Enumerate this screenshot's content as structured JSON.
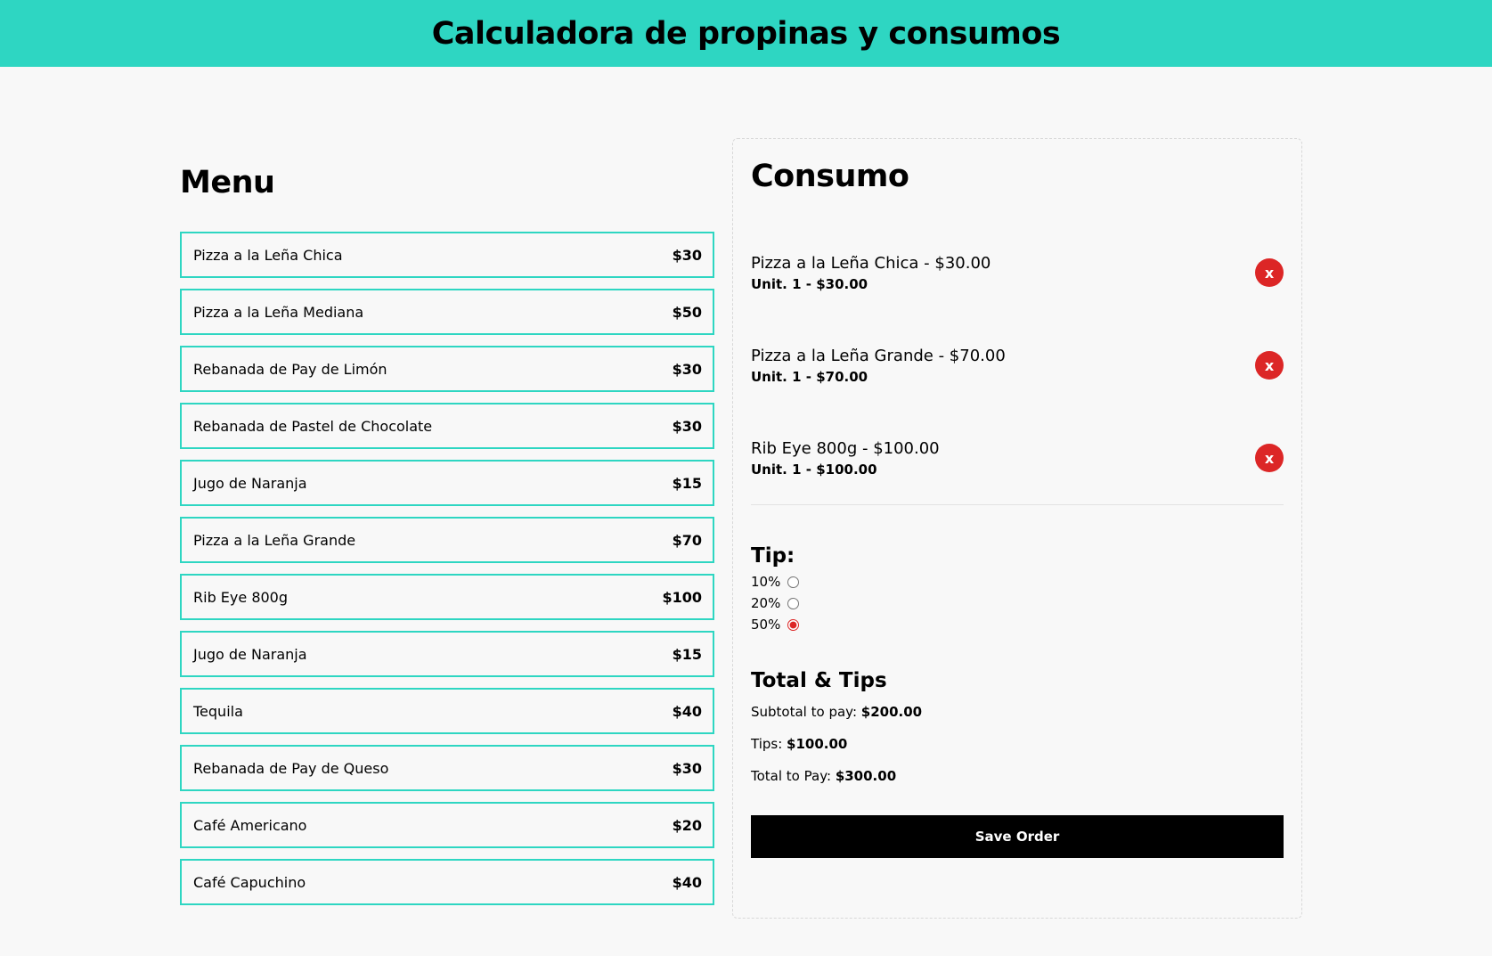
{
  "header": {
    "title": "Calculadora de propinas y consumos"
  },
  "menu": {
    "title": "Menu",
    "items": [
      {
        "name": "Pizza a la Leña Chica",
        "price": "$30"
      },
      {
        "name": "Pizza a la Leña Mediana",
        "price": "$50"
      },
      {
        "name": "Rebanada de Pay de Limón",
        "price": "$30"
      },
      {
        "name": "Rebanada de Pastel de Chocolate",
        "price": "$30"
      },
      {
        "name": "Jugo de Naranja",
        "price": "$15"
      },
      {
        "name": "Pizza a la Leña Grande",
        "price": "$70"
      },
      {
        "name": "Rib Eye 800g",
        "price": "$100"
      },
      {
        "name": "Jugo de Naranja",
        "price": "$15"
      },
      {
        "name": "Tequila",
        "price": "$40"
      },
      {
        "name": "Rebanada de Pay de Queso",
        "price": "$30"
      },
      {
        "name": "Café Americano",
        "price": "$20"
      },
      {
        "name": "Café Capuchino",
        "price": "$40"
      }
    ]
  },
  "order": {
    "title": "Consumo",
    "items": [
      {
        "label": "Pizza a la Leña Chica - $30.00",
        "unit": "Unit. 1 - $30.00",
        "remove": "x"
      },
      {
        "label": "Pizza a la Leña Grande - $70.00",
        "unit": "Unit. 1 - $70.00",
        "remove": "x"
      },
      {
        "label": "Rib Eye 800g - $100.00",
        "unit": "Unit. 1 - $100.00",
        "remove": "x"
      }
    ],
    "tip": {
      "title": "Tip:",
      "options": [
        {
          "label": "10%",
          "checked": false
        },
        {
          "label": "20%",
          "checked": false
        },
        {
          "label": "50%",
          "checked": true
        }
      ]
    },
    "totals": {
      "title": "Total & Tips",
      "subtotal_label": "Subtotal to pay:",
      "subtotal_value": "$200.00",
      "tips_label": "Tips:",
      "tips_value": "$100.00",
      "total_label": "Total to Pay:",
      "total_value": "$300.00"
    },
    "save_label": "Save Order"
  },
  "colors": {
    "accent": "#2ed6c2",
    "danger": "#dc2626",
    "button": "#000000"
  }
}
